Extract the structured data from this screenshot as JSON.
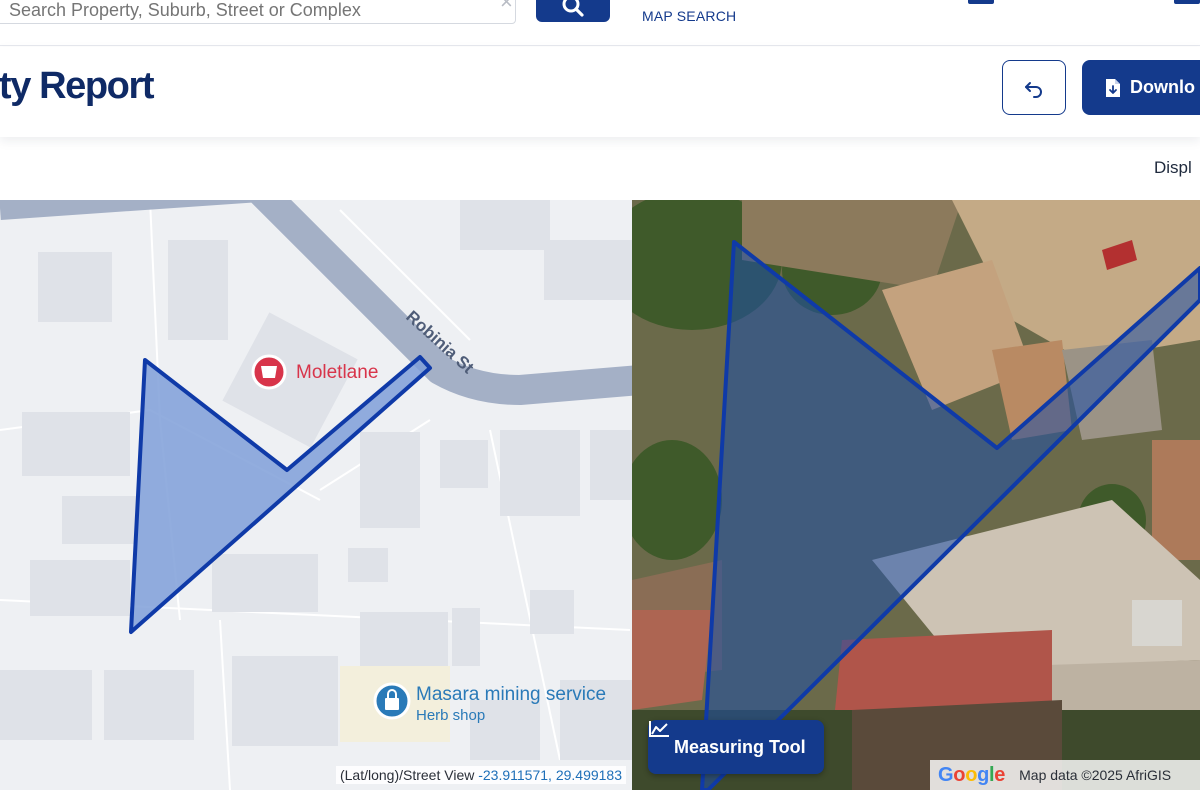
{
  "nav": {
    "search_placeholder": "Search Property, Suburb, Street or Complex",
    "search_clear_icon": "close-icon",
    "search_button_icon": "search-icon",
    "map_search_label": "MAP SEARCH"
  },
  "header": {
    "title": "perty Report",
    "back_button_icon": "undo-arrow-icon",
    "download_label": "Downlo",
    "download_icon": "file-download-icon"
  },
  "display_label": "Displ",
  "map_left": {
    "street_label": "Robinia St",
    "poi_1": {
      "name": "Moletlane",
      "icon": "store-pin-icon"
    },
    "poi_2": {
      "name": "Masara mining service",
      "category": "Herb shop",
      "icon": "shopping-bag-pin-icon"
    },
    "coords_label": "(Lat/long)/Street View",
    "coords_value": "-23.911571, 29.499183"
  },
  "map_right": {
    "measuring_tool_label": "Measuring Tool",
    "measuring_tool_icon": "area-chart-icon",
    "google_logo": "Google",
    "map_data_label": "Map data ©2025 AfriGIS"
  },
  "colors": {
    "primary": "#143a8c",
    "parcel_stroke": "#0f3aa8",
    "parcel_fill": "#7f9fd8",
    "poi_red": "#d8344a",
    "poi_blue": "#2a7ab8"
  }
}
